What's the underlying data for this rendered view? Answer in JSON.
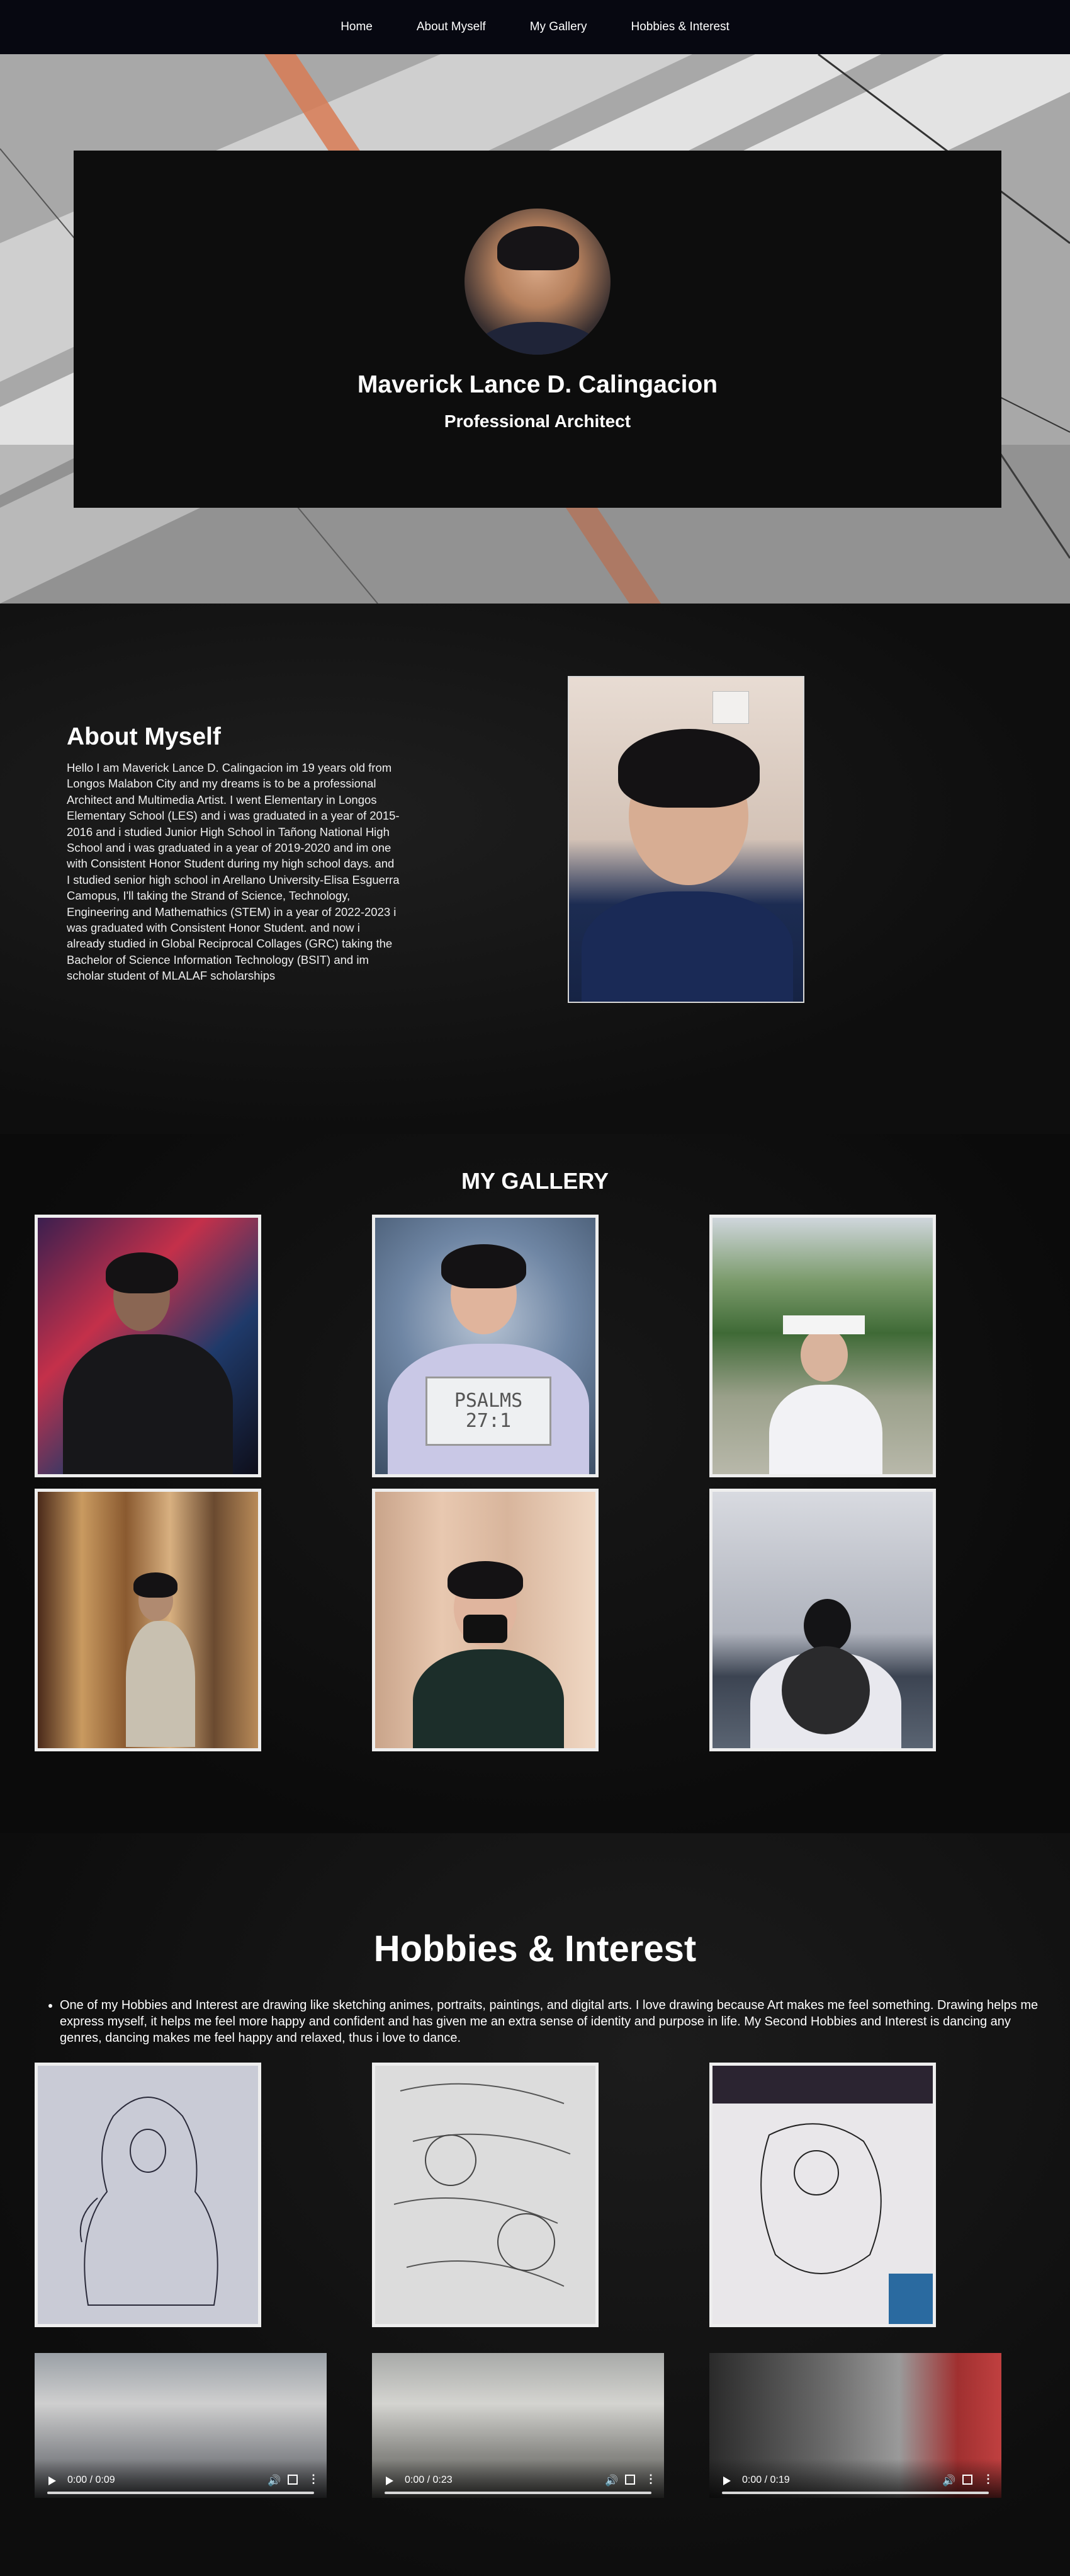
{
  "nav": {
    "items": [
      "Home",
      "About Myself",
      "My Gallery",
      "Hobbies & Interest"
    ]
  },
  "hero": {
    "name": "Maverick Lance D. Calingacion",
    "role": "Professional Architect"
  },
  "about": {
    "title": "About Myself",
    "body": "Hello I am Maverick Lance D. Calingacion im 19 years old from Longos Malabon City and my dreams is to be a professional Architect and Multimedia Artist. I went Elementary in Longos Elementary School (LES) and i was graduated in a year of 2015-2016 and i studied Junior High School in Tañong National High School and i was graduated in a year of 2019-2020 and im one with Consistent Honor Student during my high school days. and I studied senior high school in Arellano University-Elisa Esguerra Camopus, I'll taking the Strand of Science, Technology, Engineering and Mathemathics (STEM) in a year of 2022-2023 i was graduated with Consistent Honor Student. and now i already studied in Global Reciprocal Collages (GRC) taking the Bachelor of Science Information Technology (BSIT) and im scholar student of MLALAF scholarships"
  },
  "gallery": {
    "title": "MY GALLERY",
    "sign_text": "PSALMS 27:1"
  },
  "hobbies": {
    "title": "Hobbies & Interest",
    "text": "One of my Hobbies and Interest are drawing like sketching animes, portraits, paintings, and digital arts. I love drawing because Art makes me feel something. Drawing helps me express myself, it helps me feel more happy and confident and has given me an extra sense of identity and purpose in life. My Second Hobbies and Interest is dancing any genres, dancing makes me feel happy and relaxed, thus i love to dance.",
    "videos": [
      {
        "time": "0:00 / 0:09"
      },
      {
        "time": "0:00 / 0:23"
      },
      {
        "time": "0:00 / 0:19"
      }
    ]
  },
  "colors": {
    "nav_bg": "#070811",
    "card_bg": "#0d0d0d",
    "frame": "#eeeeee"
  }
}
